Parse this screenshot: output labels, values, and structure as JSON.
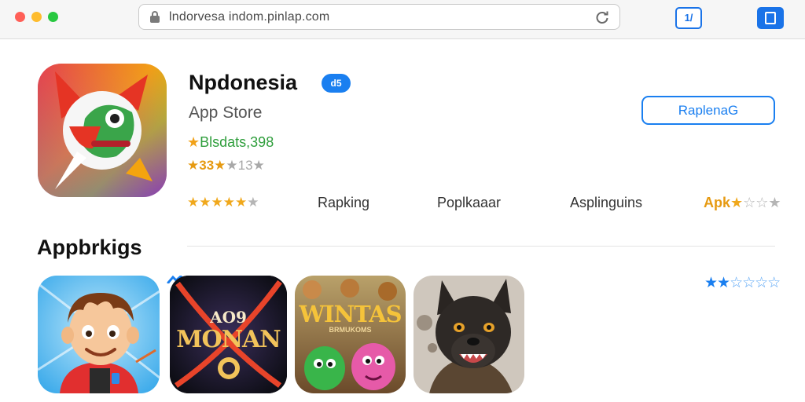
{
  "browser": {
    "url": "lndorvesa indom.pinlap.com",
    "tabs_label": "1/"
  },
  "app": {
    "name": "Npdonesia",
    "badge": "d5",
    "store": "App Store",
    "green_line_star": "★",
    "green_line_text": "Blsdats,398",
    "rating_gold": "★33★",
    "rating_rest": "★13★",
    "get_label": "RaplenaG"
  },
  "stats": {
    "stars_filled": "★★★★★",
    "stars_empty": "★",
    "ranking_label": "Rapking",
    "popular_label": "Poplkaaar",
    "languages_label": "Asplinguins",
    "age_label": "Apk",
    "age_stars_filled": "★",
    "age_stars_empty": "☆☆★"
  },
  "section": {
    "title": "Appbrkigs",
    "rating_filled": "★★",
    "rating_empty": "☆☆☆☆",
    "tiles": [
      {
        "name": "cartoon-boy"
      },
      {
        "line1": "AO9",
        "line2": "MONAN"
      },
      {
        "line1": "WINTAS",
        "line2": "BRMUKOMS"
      },
      {
        "name": "wolf"
      }
    ]
  },
  "colors": {
    "accent": "#1a7ff0",
    "star_gold": "#f0a81c",
    "green_text": "#2f9e3c"
  },
  "icons": [
    "lock-icon",
    "reload-icon",
    "tabs-icon",
    "share-icon"
  ]
}
